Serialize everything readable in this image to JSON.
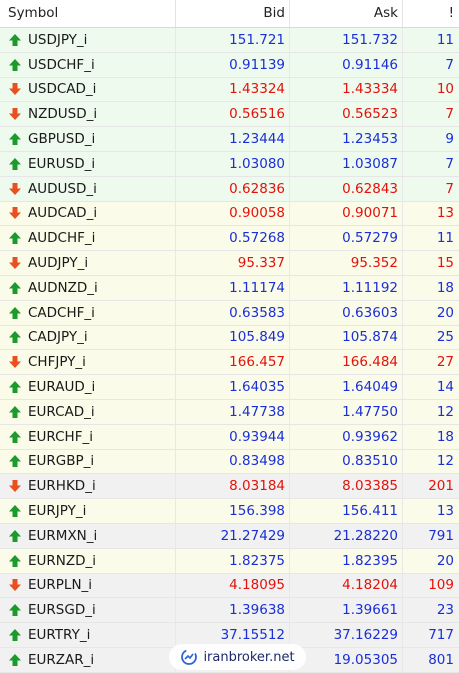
{
  "header": {
    "symbol": "Symbol",
    "bid": "Bid",
    "ask": "Ask",
    "spread": "!"
  },
  "colors": {
    "up": "#1c9a2c",
    "down": "#e8511f",
    "blue": "#1a2fd6",
    "red": "#e3120b"
  },
  "rows": [
    {
      "symbol": "USDJPY_i",
      "bid": "151.721",
      "ask": "151.732",
      "spread": "11",
      "dir": "up",
      "color": "blue",
      "bg": "green"
    },
    {
      "symbol": "USDCHF_i",
      "bid": "0.91139",
      "ask": "0.91146",
      "spread": "7",
      "dir": "up",
      "color": "blue",
      "bg": "green"
    },
    {
      "symbol": "USDCAD_i",
      "bid": "1.43324",
      "ask": "1.43334",
      "spread": "10",
      "dir": "down",
      "color": "red",
      "bg": "green"
    },
    {
      "symbol": "NZDUSD_i",
      "bid": "0.56516",
      "ask": "0.56523",
      "spread": "7",
      "dir": "down",
      "color": "red",
      "bg": "green"
    },
    {
      "symbol": "GBPUSD_i",
      "bid": "1.23444",
      "ask": "1.23453",
      "spread": "9",
      "dir": "up",
      "color": "blue",
      "bg": "green"
    },
    {
      "symbol": "EURUSD_i",
      "bid": "1.03080",
      "ask": "1.03087",
      "spread": "7",
      "dir": "up",
      "color": "blue",
      "bg": "green"
    },
    {
      "symbol": "AUDUSD_i",
      "bid": "0.62836",
      "ask": "0.62843",
      "spread": "7",
      "dir": "down",
      "color": "red",
      "bg": "green"
    },
    {
      "symbol": "AUDCAD_i",
      "bid": "0.90058",
      "ask": "0.90071",
      "spread": "13",
      "dir": "down",
      "color": "red",
      "bg": "yellow"
    },
    {
      "symbol": "AUDCHF_i",
      "bid": "0.57268",
      "ask": "0.57279",
      "spread": "11",
      "dir": "up",
      "color": "blue",
      "bg": "yellow"
    },
    {
      "symbol": "AUDJPY_i",
      "bid": "95.337",
      "ask": "95.352",
      "spread": "15",
      "dir": "down",
      "color": "red",
      "bg": "yellow"
    },
    {
      "symbol": "AUDNZD_i",
      "bid": "1.11174",
      "ask": "1.11192",
      "spread": "18",
      "dir": "up",
      "color": "blue",
      "bg": "yellow"
    },
    {
      "symbol": "CADCHF_i",
      "bid": "0.63583",
      "ask": "0.63603",
      "spread": "20",
      "dir": "up",
      "color": "blue",
      "bg": "yellow"
    },
    {
      "symbol": "CADJPY_i",
      "bid": "105.849",
      "ask": "105.874",
      "spread": "25",
      "dir": "up",
      "color": "blue",
      "bg": "yellow"
    },
    {
      "symbol": "CHFJPY_i",
      "bid": "166.457",
      "ask": "166.484",
      "spread": "27",
      "dir": "down",
      "color": "red",
      "bg": "yellow"
    },
    {
      "symbol": "EURAUD_i",
      "bid": "1.64035",
      "ask": "1.64049",
      "spread": "14",
      "dir": "up",
      "color": "blue",
      "bg": "yellow"
    },
    {
      "symbol": "EURCAD_i",
      "bid": "1.47738",
      "ask": "1.47750",
      "spread": "12",
      "dir": "up",
      "color": "blue",
      "bg": "yellow"
    },
    {
      "symbol": "EURCHF_i",
      "bid": "0.93944",
      "ask": "0.93962",
      "spread": "18",
      "dir": "up",
      "color": "blue",
      "bg": "yellow"
    },
    {
      "symbol": "EURGBP_i",
      "bid": "0.83498",
      "ask": "0.83510",
      "spread": "12",
      "dir": "up",
      "color": "blue",
      "bg": "yellow"
    },
    {
      "symbol": "EURHKD_i",
      "bid": "8.03184",
      "ask": "8.03385",
      "spread": "201",
      "dir": "down",
      "color": "red",
      "bg": "gray"
    },
    {
      "symbol": "EURJPY_i",
      "bid": "156.398",
      "ask": "156.411",
      "spread": "13",
      "dir": "up",
      "color": "blue",
      "bg": "yellow"
    },
    {
      "symbol": "EURMXN_i",
      "bid": "21.27429",
      "ask": "21.28220",
      "spread": "791",
      "dir": "up",
      "color": "blue",
      "bg": "gray"
    },
    {
      "symbol": "EURNZD_i",
      "bid": "1.82375",
      "ask": "1.82395",
      "spread": "20",
      "dir": "up",
      "color": "blue",
      "bg": "yellow"
    },
    {
      "symbol": "EURPLN_i",
      "bid": "4.18095",
      "ask": "4.18204",
      "spread": "109",
      "dir": "down",
      "color": "red",
      "bg": "gray"
    },
    {
      "symbol": "EURSGD_i",
      "bid": "1.39638",
      "ask": "1.39661",
      "spread": "23",
      "dir": "up",
      "color": "blue",
      "bg": "gray"
    },
    {
      "symbol": "EURTRY_i",
      "bid": "37.15512",
      "ask": "37.16229",
      "spread": "717",
      "dir": "up",
      "color": "blue",
      "bg": "gray"
    },
    {
      "symbol": "EURZAR_i",
      "bid": "",
      "ask": "19.05305",
      "spread": "801",
      "dir": "up",
      "color": "blue",
      "bg": "gray"
    }
  ],
  "watermark": {
    "text": "iranbroker.net",
    "icon": "chart-swirl-icon"
  }
}
